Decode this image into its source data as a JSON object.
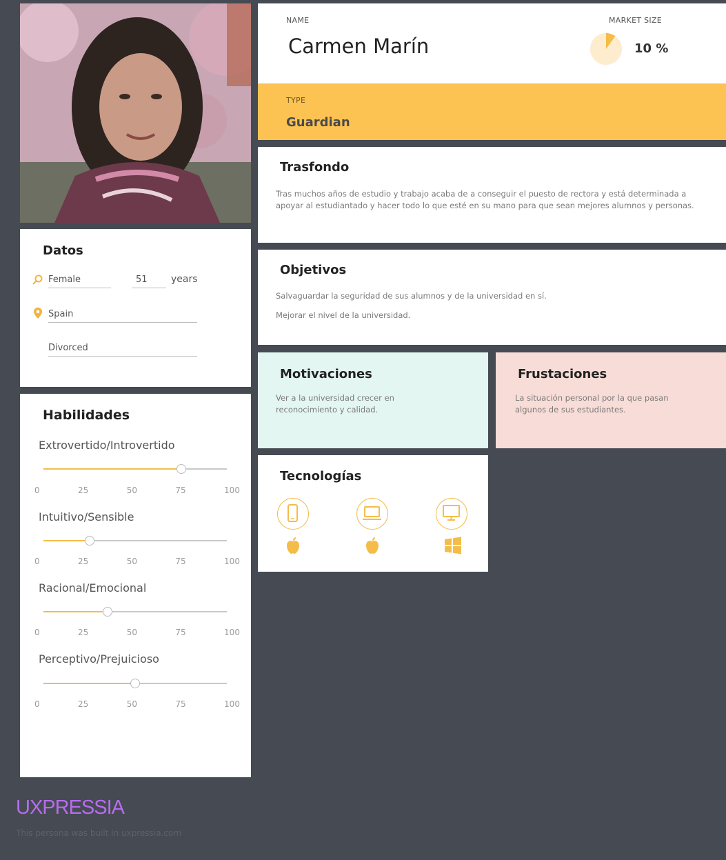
{
  "profile": {
    "name_label": "NAME",
    "name": "Carmen Marín",
    "market_label": "MARKET SIZE",
    "market_value": "10 %",
    "market_fraction": 0.1,
    "type_label": "TYPE",
    "type": "Guardian"
  },
  "datos": {
    "title": "Datos",
    "gender": "Female",
    "age": "51",
    "age_unit": "years",
    "country": "Spain",
    "status": "Divorced"
  },
  "habilidades": {
    "title": "Habilidades",
    "ticks": [
      "0",
      "25",
      "50",
      "75",
      "100"
    ],
    "skills": [
      {
        "label": "Extrovertido/Introvertido",
        "value": 75
      },
      {
        "label": "Intuitivo/Sensible",
        "value": 25
      },
      {
        "label": "Racional/Emocional",
        "value": 35
      },
      {
        "label": "Perceptivo/Prejuicioso",
        "value": 50
      }
    ]
  },
  "trasfondo": {
    "title": "Trasfondo",
    "text": "Tras muchos años de estudio y trabajo acaba de a conseguir el puesto de rectora  y está determinada a apoyar al estudiantado y hacer todo lo que esté en su mano para que sean mejores alumnos y personas."
  },
  "objetivos": {
    "title": "Objetivos",
    "items": [
      "Salvaguardar la seguridad de sus alumnos y de la universidad en sí.",
      "Mejorar el nivel de la universidad."
    ]
  },
  "motivaciones": {
    "title": "Motivaciones",
    "text": "Ver a la universidad crecer en reconocimiento y calidad."
  },
  "frustaciones": {
    "title": "Frustaciones",
    "text": "La situación personal por la que pasan algunos de sus estudiantes."
  },
  "tecnologias": {
    "title": "Tecnologías",
    "devices": [
      "smartphone-icon",
      "laptop-icon",
      "desktop-icon"
    ],
    "os": [
      "apple-icon",
      "apple-icon",
      "windows-icon"
    ]
  },
  "footer": {
    "logo": "UXPRESSIA",
    "built": "This persona was built in uxpressia.com"
  },
  "colors": {
    "background": "#464a52",
    "accent": "#fdc352",
    "motivaciones_bg": "#e3f6f1",
    "frustaciones_bg": "#f8dcd7",
    "logo": "#b76cf0"
  }
}
